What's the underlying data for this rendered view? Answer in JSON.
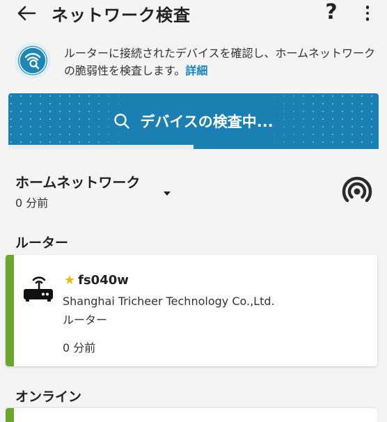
{
  "header": {
    "title": "ネットワーク検査",
    "help_label": "?"
  },
  "info": {
    "text": "ルーターに接続されたデバイスを確認し、ホームネットワークの脆弱性を検査します。",
    "link": "詳細"
  },
  "scan": {
    "label": "デバイスの検査中...",
    "progress": 0.5
  },
  "network": {
    "name": "ホームネットワーク",
    "time": "0 分前"
  },
  "sections": {
    "router": "ルーター",
    "online": "オンライン"
  },
  "device": {
    "name": "fs040w",
    "vendor": "Shanghai Tricheer Technology Co.,Ltd.",
    "type": "ルーター",
    "time": "0 分前",
    "favorite": true,
    "accent_color": "#6aa52d"
  },
  "colors": {
    "banner": "#1a7fb2",
    "link": "#1584c6",
    "star": "#f5b800"
  }
}
